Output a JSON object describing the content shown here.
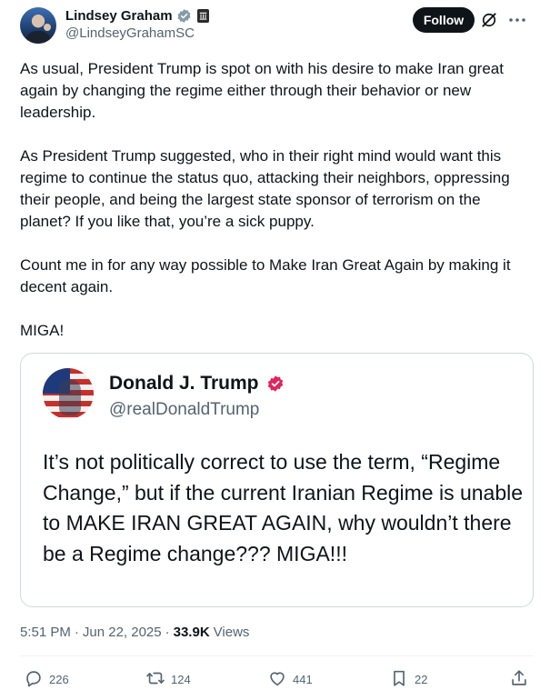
{
  "author": {
    "display_name": "Lindsey Graham",
    "handle": "@LindseyGrahamSC"
  },
  "header": {
    "follow_label": "Follow"
  },
  "tweet": {
    "text": "As usual, President Trump is spot on with his desire to make Iran great again by changing the regime either through their behavior or new leadership.\n\nAs President Trump suggested, who in their right mind would want this regime to continue the status quo, attacking their neighbors, oppressing their people, and being the largest state sponsor of terrorism on the planet? If you like that, you’re a sick puppy.\n\nCount me in for any way possible to Make Iran Great Again by making it decent again.\n\nMIGA!"
  },
  "quote": {
    "display_name": "Donald J. Trump",
    "handle": "@realDonaldTrump",
    "text": "It’s not politically correct to use the term, “Regime Change,” but if the current Iranian Regime is unable to MAKE IRAN GREAT AGAIN, why wouldn’t there be a Regime change??? MIGA!!!"
  },
  "meta": {
    "time": "5:51 PM",
    "separator": "·",
    "date": "Jun 22, 2025",
    "views_count": "33.9K",
    "views_label": "Views"
  },
  "actions": {
    "replies": "226",
    "reposts": "124",
    "likes": "441",
    "bookmarks": "22"
  },
  "colors": {
    "text": "#0f1419",
    "secondary": "#536471",
    "border": "#cfd9de",
    "verified_blue": "#1d9bf0",
    "verified_pink": "#e0245e"
  }
}
